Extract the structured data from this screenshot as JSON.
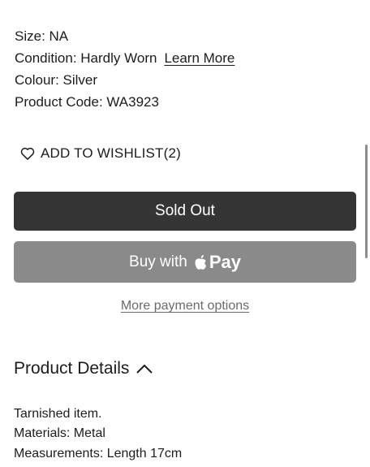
{
  "attributes": {
    "size": "Size: NA",
    "condition": "Condition: Hardly Worn",
    "learn_more": "Learn More",
    "colour": "Colour: Silver",
    "product_code": "Product Code: WA3923"
  },
  "wishlist": {
    "label": "ADD TO WISHLIST",
    "count": "(2)",
    "icon": "heart-outline-icon"
  },
  "buttons": {
    "sold_out": "Sold Out",
    "buy_with": "Buy with",
    "pay": "Pay",
    "apple_icon": "apple-logo-icon"
  },
  "more_payment": "More payment options",
  "product_details": {
    "title": "Product Details",
    "icon": "chevron-up-icon",
    "lines": [
      "Tarnished item.",
      "Materials: Metal",
      "Measurements: Length 17cm"
    ]
  },
  "colors": {
    "sold_out_bg": "#353535",
    "apple_pay_bg": "#8a8a8a",
    "link_grey": "#6b6b6b"
  }
}
